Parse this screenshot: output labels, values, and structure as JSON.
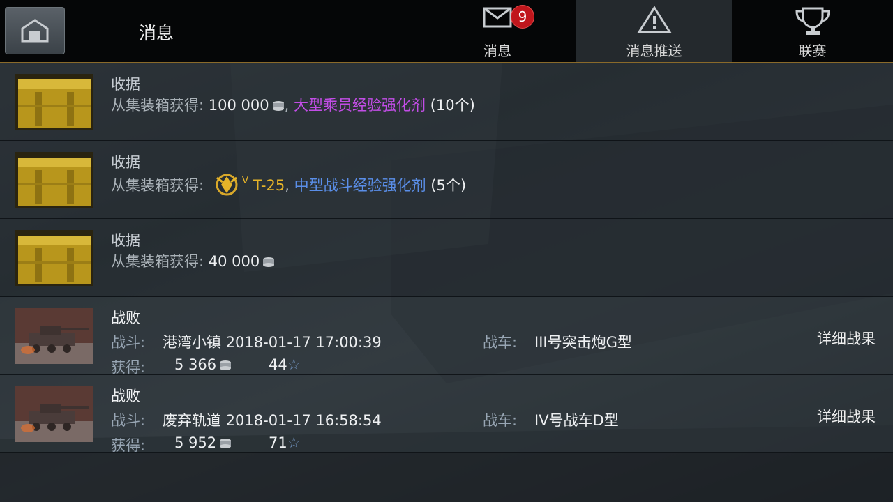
{
  "header": {
    "title": "消息",
    "tabs": [
      {
        "label": "消息",
        "icon": "envelope-icon",
        "badge": "9"
      },
      {
        "label": "消息推送",
        "icon": "warning-icon",
        "active": true
      },
      {
        "label": "联赛",
        "icon": "trophy-icon"
      }
    ]
  },
  "rewards": [
    {
      "title": "收据",
      "source_label": "从集装箱获得:",
      "amount": "100 000",
      "item": "大型乘员经验强化剂",
      "item_color": "#c24de6",
      "count": "(10个)"
    },
    {
      "title": "收据",
      "source_label": "从集装箱获得:",
      "tank_tier": "V",
      "tank": "T-25",
      "item": "中型战斗经验强化剂",
      "item_color": "#5a8ee8",
      "count": "(5个)"
    },
    {
      "title": "收据",
      "source_label": "从集装箱获得:",
      "amount": "40 000"
    }
  ],
  "battles": [
    {
      "result": "战败",
      "battle_label": "战斗:",
      "battle_value": "港湾小镇 2018-01-17 17:00:39",
      "vehicle_label": "战车:",
      "vehicle_value": "III号突击炮G型",
      "earned_label": "获得:",
      "credits": "5 366",
      "xp": "44",
      "details": "详细战果"
    },
    {
      "result": "战败",
      "battle_label": "战斗:",
      "battle_value": "废弃轨道 2018-01-17 16:58:54",
      "vehicle_label": "战车:",
      "vehicle_value": "IV号战车D型",
      "earned_label": "获得:",
      "credits": "5 952",
      "xp": "71",
      "details": "详细战果"
    }
  ],
  "colors": {
    "accent": "#8a6a2a",
    "badge": "#c0161c",
    "gold": "#e6b429"
  }
}
